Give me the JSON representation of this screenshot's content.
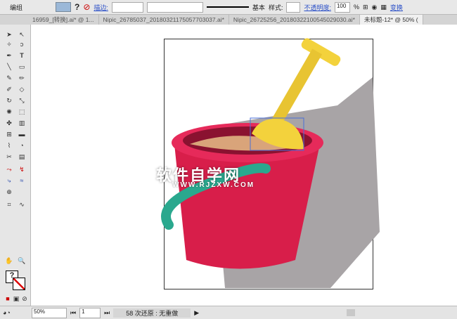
{
  "control_bar": {
    "label": "编组",
    "stroke_label": "描边:",
    "stroke_style": "基本",
    "style_label": "样式:",
    "opacity_label": "不透明度:",
    "opacity_value": "100",
    "percent": "%",
    "transform_label": "变换",
    "help": "?"
  },
  "tabs": [
    {
      "label": "16959_[转换].ai* @ 1..."
    },
    {
      "label": "Nipic_26785037_20180321175057703037.ai*"
    },
    {
      "label": "Nipic_26725256_20180322100545029030.ai*"
    },
    {
      "label": "未标题-12* @ 50% (",
      "active": true
    }
  ],
  "watermark": {
    "title": "软件自学网",
    "url": "WWW.RJZXW.COM"
  },
  "status": {
    "zoom": "50%",
    "page": "1",
    "message": "58 次还原 : 无重做"
  },
  "colors": {
    "bucket": "#d81e4a",
    "handle": "#2aa88e",
    "shovel": "#f0d040",
    "sand": "#d9a47a"
  }
}
